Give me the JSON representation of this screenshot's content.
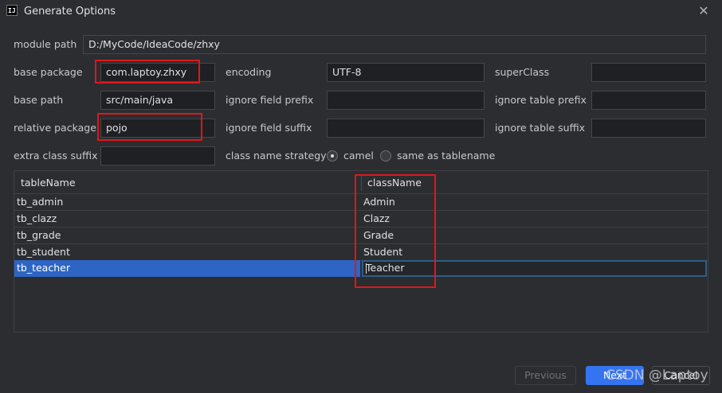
{
  "window": {
    "title": "Generate Options",
    "app_icon": "IJ"
  },
  "form": {
    "module_path_label": "module path",
    "module_path_value": "D:/MyCode/IdeaCode/zhxy",
    "base_package_label": "base package",
    "base_package_value": "com.laptoy.zhxy",
    "encoding_label": "encoding",
    "encoding_value": "UTF-8",
    "superclass_label": "superClass",
    "superclass_value": "",
    "base_path_label": "base path",
    "base_path_value": "src/main/java",
    "ignore_field_prefix_label": "ignore field prefix",
    "ignore_field_prefix_value": "",
    "ignore_table_prefix_label": "ignore table prefix",
    "ignore_table_prefix_value": "",
    "relative_package_label": "relative package",
    "relative_package_value": "pojo",
    "ignore_field_suffix_label": "ignore field suffix",
    "ignore_field_suffix_value": "",
    "ignore_table_suffix_label": "ignore table suffix",
    "ignore_table_suffix_value": "",
    "extra_class_suffix_label": "extra class suffix",
    "extra_class_suffix_value": "",
    "class_name_strategy_label": "class name strategy",
    "strategy_options": [
      {
        "label": "camel",
        "selected": true
      },
      {
        "label": "same as tablename",
        "selected": false
      }
    ]
  },
  "table": {
    "headers": [
      "tableName",
      "className"
    ],
    "rows": [
      {
        "tableName": "tb_admin",
        "className": "Admin"
      },
      {
        "tableName": "tb_clazz",
        "className": "Clazz"
      },
      {
        "tableName": "tb_grade",
        "className": "Grade"
      },
      {
        "tableName": "tb_student",
        "className": "Student"
      },
      {
        "tableName": "tb_teacher",
        "className": "Teacher",
        "selected": true
      }
    ]
  },
  "buttons": {
    "previous": "Previous",
    "next": "Next",
    "cancel": "Cancel"
  },
  "watermark": "CSDN @Laptoy",
  "colors": {
    "background": "#2b2d30",
    "selection": "#2e65c5",
    "highlight_box": "#e0161b",
    "primary_button": "#3574f0"
  }
}
